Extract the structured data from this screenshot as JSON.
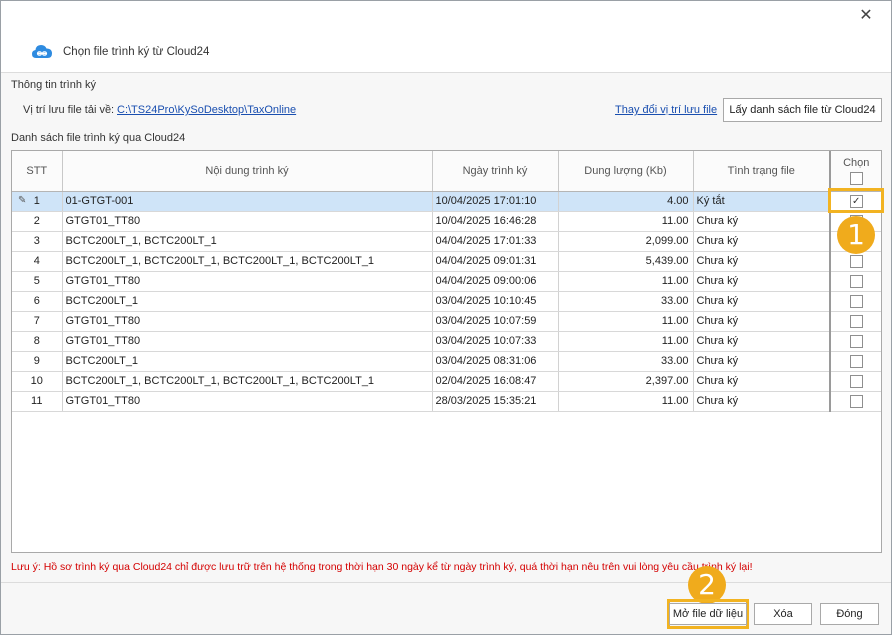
{
  "window": {
    "title": "Chọn file trình ký từ Cloud24",
    "close_glyph": "✕"
  },
  "info": {
    "section_label": "Thông tin trình ký",
    "path_label": "Vị trí lưu file tải về:",
    "path_value": "C:\\TS24Pro\\KySoDesktop\\TaxOnline",
    "change_location": "Thay đổi vị trí lưu file",
    "fetch_button": "Lấy danh sách file từ Cloud24"
  },
  "list": {
    "section_label": "Danh sách file trình ký qua Cloud24",
    "columns": {
      "stt": "STT",
      "content": "Nội dung trình ký",
      "date": "Ngày trình ký",
      "size": "Dung lượng (Kb)",
      "status": "Tình trạng file",
      "select": "Chọn"
    },
    "rows": [
      {
        "stt": "1",
        "content": "01-GTGT-001",
        "date": "10/04/2025 17:01:10",
        "size": "4.00",
        "status": "Ký tắt",
        "checked": true,
        "selected": true
      },
      {
        "stt": "2",
        "content": "GTGT01_TT80",
        "date": "10/04/2025 16:46:28",
        "size": "11.00",
        "status": "Chưa ký",
        "checked": false
      },
      {
        "stt": "3",
        "content": "BCTC200LT_1, BCTC200LT_1",
        "date": "04/04/2025 17:01:33",
        "size": "2,099.00",
        "status": "Chưa ký",
        "checked": false
      },
      {
        "stt": "4",
        "content": "BCTC200LT_1, BCTC200LT_1, BCTC200LT_1, BCTC200LT_1",
        "date": "04/04/2025 09:01:31",
        "size": "5,439.00",
        "status": "Chưa ký",
        "checked": false
      },
      {
        "stt": "5",
        "content": "GTGT01_TT80",
        "date": "04/04/2025 09:00:06",
        "size": "11.00",
        "status": "Chưa ký",
        "checked": false
      },
      {
        "stt": "6",
        "content": "BCTC200LT_1",
        "date": "03/04/2025 10:10:45",
        "size": "33.00",
        "status": "Chưa ký",
        "checked": false
      },
      {
        "stt": "7",
        "content": "GTGT01_TT80",
        "date": "03/04/2025 10:07:59",
        "size": "11.00",
        "status": "Chưa ký",
        "checked": false
      },
      {
        "stt": "8",
        "content": "GTGT01_TT80",
        "date": "03/04/2025 10:07:33",
        "size": "11.00",
        "status": "Chưa ký",
        "checked": false
      },
      {
        "stt": "9",
        "content": "BCTC200LT_1",
        "date": "03/04/2025 08:31:06",
        "size": "33.00",
        "status": "Chưa ký",
        "checked": false
      },
      {
        "stt": "10",
        "content": "BCTC200LT_1, BCTC200LT_1, BCTC200LT_1, BCTC200LT_1",
        "date": "02/04/2025 16:08:47",
        "size": "2,397.00",
        "status": "Chưa ký",
        "checked": false
      },
      {
        "stt": "11",
        "content": "GTGT01_TT80",
        "date": "28/03/2025 15:35:21",
        "size": "11.00",
        "status": "Chưa ký",
        "checked": false
      }
    ]
  },
  "note": "Lưu ý: Hồ sơ trình ký qua Cloud24 chỉ được lưu trữ trên hệ thống trong thời hạn 30 ngày kể từ ngày trình ký, quá thời hạn nêu trên vui lòng yêu cầu trình ký lại!",
  "footer": {
    "open_button": "Mở file dữ liệu",
    "delete_button": "Xóa",
    "close_button": "Đóng"
  },
  "callouts": {
    "step1": "1",
    "step2": "2",
    "color": "#f0ab1c"
  }
}
